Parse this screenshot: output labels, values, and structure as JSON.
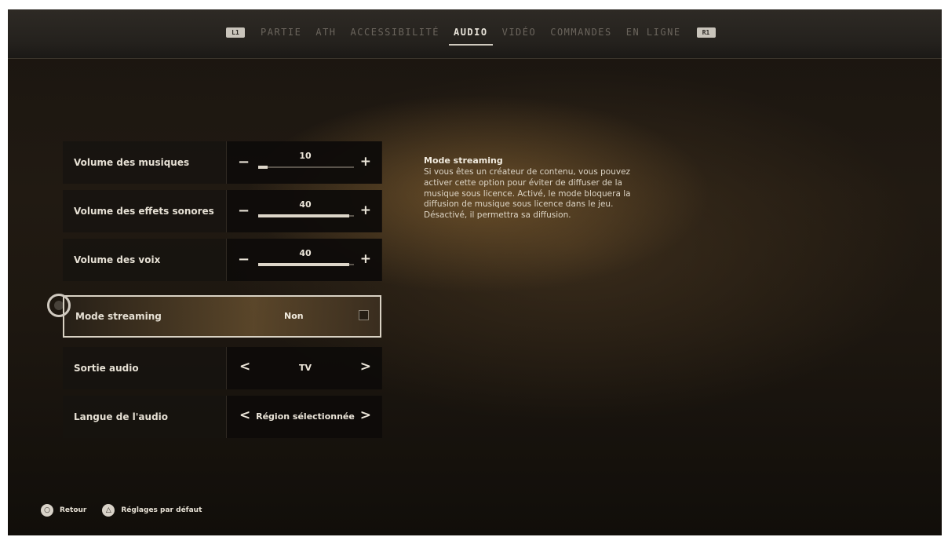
{
  "tabs": {
    "left_shoulder": "L1",
    "right_shoulder": "R1",
    "items": [
      "PARTIE",
      "ATH",
      "ACCESSIBILITÉ",
      "AUDIO",
      "VIDÉO",
      "COMMANDES",
      "EN LIGNE"
    ],
    "active": "AUDIO"
  },
  "settings": [
    {
      "label": "Volume des musiques",
      "type": "slider",
      "value": "10",
      "level": 0.1
    },
    {
      "label": "Volume des effets sonores",
      "type": "slider",
      "value": "40",
      "level": 0.95
    },
    {
      "label": "Volume des voix",
      "type": "slider",
      "value": "40",
      "level": 0.95
    },
    {
      "label": "Mode streaming",
      "type": "toggle",
      "value": "Non",
      "checked": false
    },
    {
      "label": "Sortie audio",
      "type": "selector",
      "value": "TV"
    },
    {
      "label": "Langue de l'audio",
      "type": "selector",
      "value": "Région sélectionnée"
    }
  ],
  "description": {
    "title": "Mode streaming",
    "body": "Si vous êtes un créateur de contenu, vous pouvez activer cette option pour éviter de diffuser de la musique sous licence. Activé, le mode bloquera la diffusion de musique sous licence dans le jeu. Désactivé, il permettra sa diffusion."
  },
  "footer": {
    "back_label": "Retour",
    "defaults_label": "Réglages par défaut",
    "back_icon": "circle-button-icon",
    "defaults_icon": "triangle-button-icon"
  }
}
